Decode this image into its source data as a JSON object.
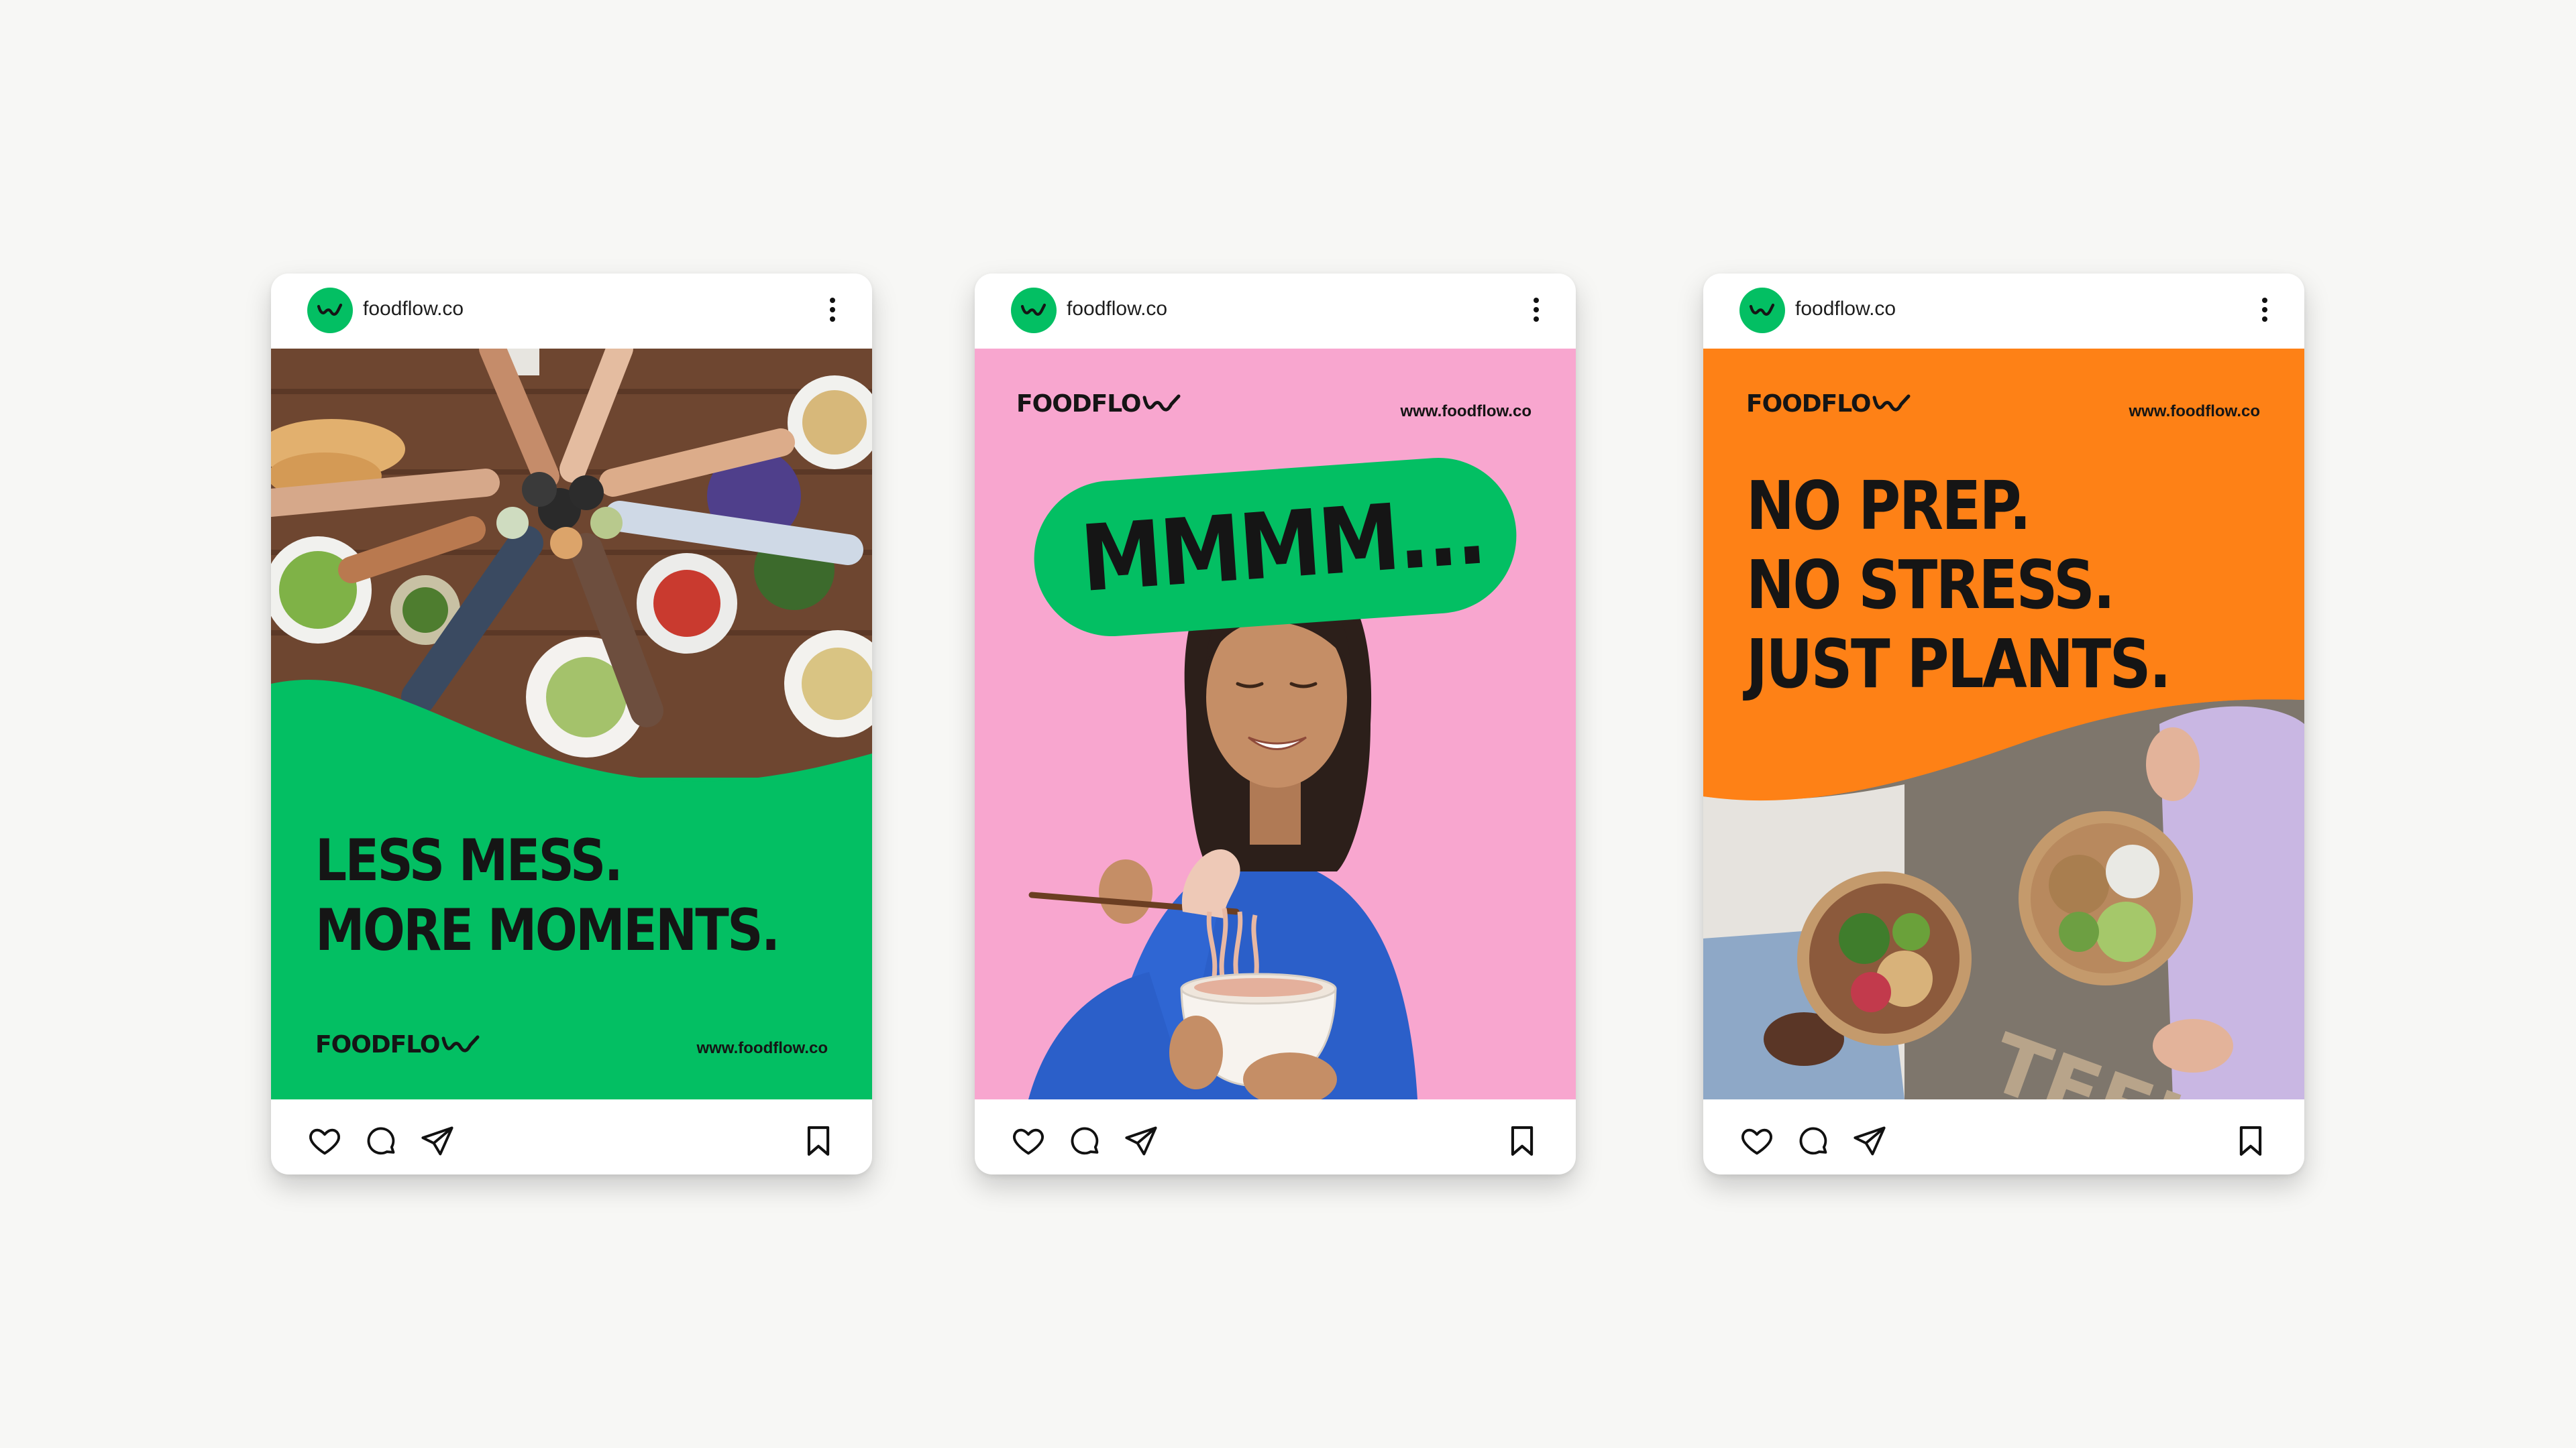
{
  "colors": {
    "background": "#f7f7f5",
    "brand_green": "#03bf63",
    "brand_pink": "#f8a6cf",
    "brand_orange": "#fe8116",
    "ink": "#151515"
  },
  "posts": [
    {
      "handle": "foodflow.co",
      "icons": [
        "heart-icon",
        "comment-icon",
        "send-icon",
        "bookmark-icon",
        "more-options-icon"
      ],
      "creative": {
        "headline": [
          "LESS MESS.",
          "MORE MOMENTS."
        ],
        "logo": "FOODFLO",
        "url": "www.foodflow.co",
        "photo": "overhead dinner table, friends toasting"
      }
    },
    {
      "handle": "foodflow.co",
      "icons": [
        "heart-icon",
        "comment-icon",
        "send-icon",
        "bookmark-icon",
        "more-options-icon"
      ],
      "creative": {
        "bubble_text": "MMMM...",
        "logo": "FOODFLO",
        "url": "www.foodflow.co",
        "photo": "smiling woman eating noodles with chopsticks"
      }
    },
    {
      "handle": "foodflow.co",
      "icons": [
        "heart-icon",
        "comment-icon",
        "send-icon",
        "bookmark-icon",
        "more-options-icon"
      ],
      "creative": {
        "headline": [
          "NO PREP.",
          "NO STRESS.",
          "JUST PLANTS."
        ],
        "logo": "FOODFLO",
        "url": "www.foodflow.co",
        "photo": "two people holding plant-based bowls"
      }
    }
  ]
}
